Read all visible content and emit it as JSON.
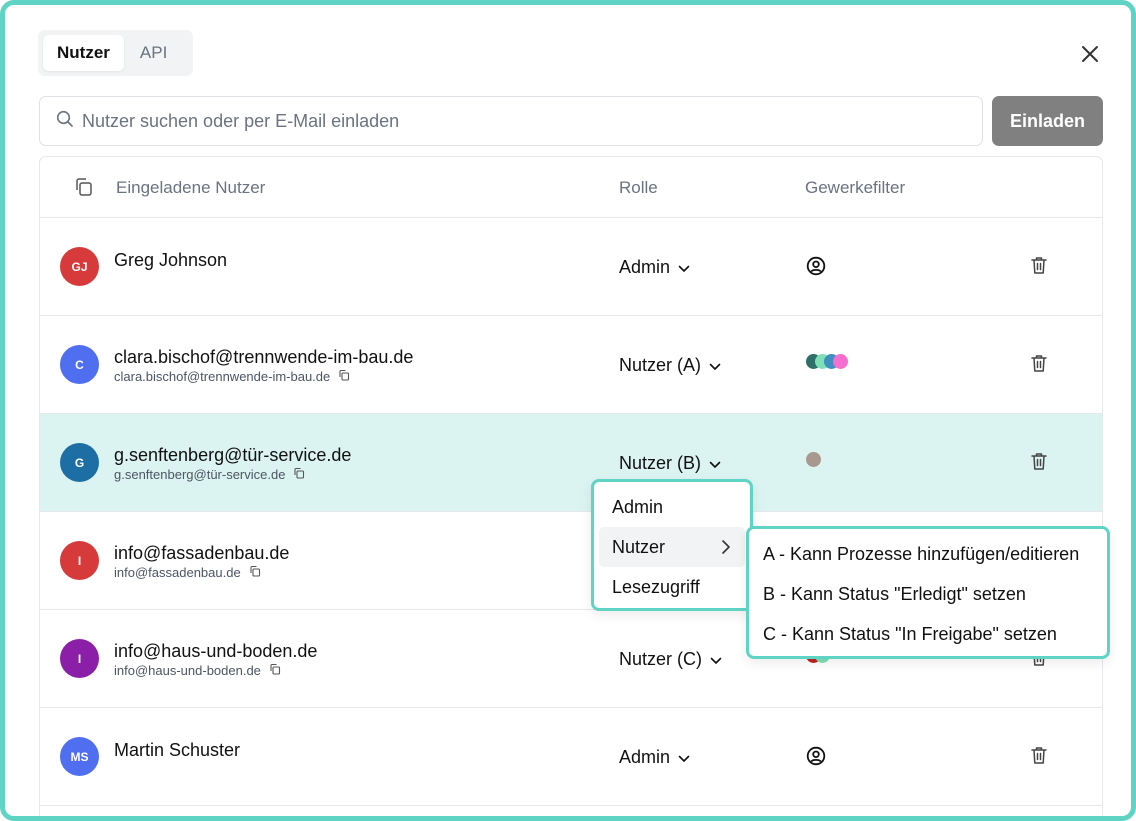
{
  "tabs": [
    {
      "label": "Nutzer",
      "active": true
    },
    {
      "label": "API",
      "active": false
    }
  ],
  "search": {
    "placeholder": "Nutzer suchen oder per E-Mail einladen"
  },
  "invite_label": "Einladen",
  "table": {
    "headers": {
      "user": "Eingeladene Nutzer",
      "role": "Rolle",
      "filter": "Gewerkefilter"
    },
    "rows": [
      {
        "initials": "GJ",
        "avatar_color": "#d63a3a",
        "name": "Greg Johnson",
        "email": "",
        "role": "Admin",
        "filter_icon": "user-circle-icon",
        "filter_colors": []
      },
      {
        "initials": "C",
        "avatar_color": "#4f6ef0",
        "name": "clara.bischof@trennwende-im-bau.de",
        "email": "clara.bischof@trennwende-im-bau.de",
        "role": "Nutzer (A)",
        "filter_icon": "",
        "filter_colors": [
          "#2f6f6a",
          "#7fe0b8",
          "#3f8fc0",
          "#f46fd0"
        ]
      },
      {
        "initials": "G",
        "avatar_color": "#1e6ea6",
        "name": "g.senftenberg@tür-service.de",
        "email": "g.senftenberg@tür-service.de",
        "role": "Nutzer (B)",
        "filter_icon": "",
        "filter_colors": [
          "#a89890"
        ]
      },
      {
        "initials": "I",
        "avatar_color": "#d63a3a",
        "name": "info@fassadenbau.de",
        "email": "info@fassadenbau.de",
        "role": "",
        "filter_icon": "",
        "filter_colors": []
      },
      {
        "initials": "I",
        "avatar_color": "#8b1fa8",
        "name": "info@haus-und-boden.de",
        "email": "info@haus-und-boden.de",
        "role": "Nutzer (C)",
        "filter_icon": "",
        "filter_colors": [
          "#c0231f",
          "#7fe0b8"
        ]
      },
      {
        "initials": "MS",
        "avatar_color": "#4f6ef0",
        "name": "Martin Schuster",
        "email": "",
        "role": "Admin",
        "filter_icon": "user-circle-icon",
        "filter_colors": []
      }
    ]
  },
  "role_menu": {
    "items": [
      "Admin",
      "Nutzer",
      "Lesezugriff"
    ]
  },
  "role_submenu": {
    "items": [
      "A - Kann Prozesse hinzufügen/editieren",
      "B - Kann Status \"Erledigt\" setzen",
      "C - Kann Status \"In Freigabe\" setzen"
    ]
  },
  "colors": {
    "accent": "#5fd3c4",
    "highlight_row": "#dcf4f1",
    "invite_button": "#808080"
  }
}
